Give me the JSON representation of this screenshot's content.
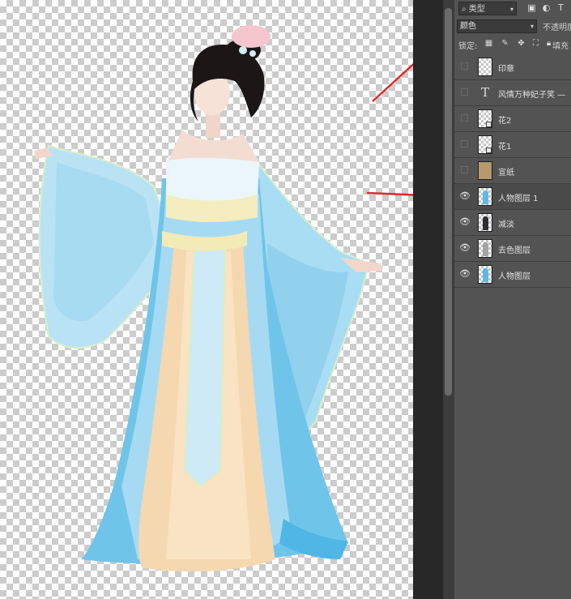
{
  "layers_panel": {
    "filter_kind": "类型",
    "blend_mode": "颜色",
    "opacity_label": "不透明度",
    "lock_label": "锁定:",
    "fill_label": "填充",
    "layers": [
      {
        "name": "印章",
        "visible": false,
        "thumb": "checker"
      },
      {
        "name": "风情万种妃子笑 —",
        "visible": false,
        "thumb": "text"
      },
      {
        "name": "花2",
        "visible": false,
        "thumb": "checker"
      },
      {
        "name": "花1",
        "visible": false,
        "thumb": "checker"
      },
      {
        "name": "宣纸",
        "visible": false,
        "thumb": "paper"
      },
      {
        "name": "人物图层 1",
        "visible": true,
        "thumb": "figure-blue",
        "selected": true
      },
      {
        "name": "减淡",
        "visible": true,
        "thumb": "figure-dark"
      },
      {
        "name": "去色图层",
        "visible": true,
        "thumb": "figure-gray"
      },
      {
        "name": "人物图层",
        "visible": true,
        "thumb": "figure-blue"
      }
    ]
  },
  "icons": {
    "search": "search-icon",
    "eye": "eye-icon",
    "lock": "lock-icon"
  },
  "colors": {
    "annotation_arrow": "#e02b2b",
    "panel_bg": "#535353",
    "dress_blue": "#8fd0ee",
    "skirt_peach": "#f6d8b0"
  }
}
